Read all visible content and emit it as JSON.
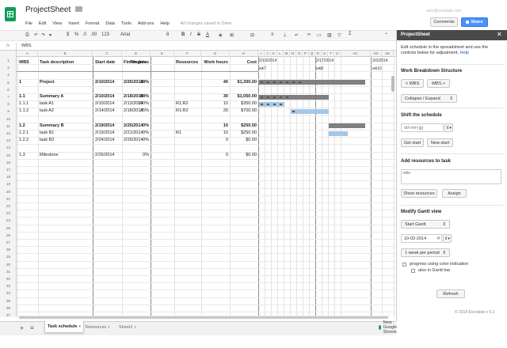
{
  "app": {
    "title": "ProjectSheet",
    "save_status": "All changes saved in Drive",
    "comments_label": "Comments",
    "share_label": "Share",
    "user_email": "user@example.com"
  },
  "menu": [
    "File",
    "Edit",
    "View",
    "Insert",
    "Format",
    "Data",
    "Tools",
    "Add-ons",
    "Help"
  ],
  "toolbar": {
    "zoom": "123",
    "font": "Arial",
    "font_size": "8"
  },
  "formula_bar": {
    "fx": "fx",
    "value": "WBS"
  },
  "columns": [
    "A",
    "B",
    "C",
    "D",
    "E",
    "F",
    "G",
    "H",
    "I",
    "J",
    "K",
    "L",
    "M",
    "N",
    "O",
    "P",
    "Q",
    "R",
    "S",
    "T",
    "U",
    "AC",
    "AD",
    "AE"
  ],
  "header_row": {
    "wbs": "WBS",
    "task": "Task description",
    "start": "Start date",
    "finish": "Finish date",
    "progress": "Progress",
    "resources": "Resources",
    "work": "Work hours",
    "cost": "Cost"
  },
  "gantt_header": {
    "date1": "2/10/2014",
    "wk1": "wk7",
    "date2": "2/17/2014",
    "wk2": "wk8",
    "date3": "3/3/2014",
    "wk3": "wk10"
  },
  "rows": [
    {
      "n": "1",
      "wbs": "WBS",
      "task": "Task description",
      "start": "Start date",
      "finish": "Finish date",
      "progress": "Progress",
      "resources": "Resources",
      "work": "Work hours",
      "cost": "Cost",
      "bold": true
    },
    {
      "n": "2",
      "wbs": "",
      "task": "",
      "start": "",
      "finish": "",
      "progress": "",
      "resources": "",
      "work": "",
      "cost": ""
    },
    {
      "n": "4",
      "wbs": "",
      "task": "",
      "start": "",
      "finish": "",
      "progress": "",
      "resources": "",
      "work": "",
      "cost": ""
    },
    {
      "n": "5",
      "wbs": "1",
      "task": "Project",
      "start": "2/10/2014",
      "finish": "2/26/2014",
      "progress": "38%",
      "resources": "",
      "work": "40",
      "cost": "$1,300.00",
      "bold": true
    },
    {
      "n": "6",
      "wbs": "",
      "task": "",
      "start": "",
      "finish": "",
      "progress": "",
      "resources": "",
      "work": "",
      "cost": ""
    },
    {
      "n": "7",
      "wbs": "1.1",
      "task": "Summary A",
      "start": "2/10/2014",
      "finish": "2/18/2014",
      "progress": "58%",
      "resources": "",
      "work": "30",
      "cost": "$1,050.00",
      "bold": true
    },
    {
      "n": "8",
      "wbs": "1.1.1",
      "task": "task A1",
      "start": "2/10/2014",
      "finish": "2/13/2014",
      "progress": "100%",
      "resources": "R1;R2",
      "work": "10",
      "cost": "$350.00"
    },
    {
      "n": "9",
      "wbs": "1.1.2",
      "task": "task A2",
      "start": "2/14/2014",
      "finish": "2/18/2014",
      "progress": "25%",
      "resources": "R1;R2",
      "work": "20",
      "cost": "$700.00"
    },
    {
      "n": "10",
      "wbs": "",
      "task": "",
      "start": "",
      "finish": "",
      "progress": "",
      "resources": "",
      "work": "",
      "cost": ""
    },
    {
      "n": "11",
      "wbs": "1.2",
      "task": "Summary B",
      "start": "2/19/2014",
      "finish": "2/25/2014",
      "progress": "0%",
      "resources": "",
      "work": "10",
      "cost": "$250.00",
      "bold": true
    },
    {
      "n": "12",
      "wbs": "1.2.1",
      "task": "task B1",
      "start": "2/19/2014",
      "finish": "2/21/2014",
      "progress": "0%",
      "resources": "R1",
      "work": "10",
      "cost": "$250.00"
    },
    {
      "n": "13",
      "wbs": "1.2.2",
      "task": "task B2",
      "start": "2/24/2014",
      "finish": "2/25/2014",
      "progress": "0%",
      "resources": "",
      "work": "0",
      "cost": "$0.00"
    },
    {
      "n": "14",
      "wbs": "",
      "task": "",
      "start": "",
      "finish": "",
      "progress": "",
      "resources": "",
      "work": "",
      "cost": ""
    },
    {
      "n": "15",
      "wbs": "1.3",
      "task": "Milestone",
      "start": "2/26/2014",
      "finish": "",
      "progress": "0%",
      "resources": "",
      "work": "0",
      "cost": "$0.00"
    }
  ],
  "empty_rows": [
    "16",
    "17",
    "18",
    "19",
    "20",
    "21",
    "22",
    "23",
    "24",
    "25",
    "26",
    "27",
    "28",
    "29",
    "30",
    "31",
    "32",
    "33",
    "34",
    "35",
    "36",
    "37",
    "38"
  ],
  "sheets": {
    "active": "Task schedule",
    "others": [
      "Resources",
      "Sheet1"
    ],
    "notice": "New Google Sheets"
  },
  "sidebar": {
    "title": "ProjectSheet",
    "intro": "Edit schedule in the spreadsheet and use the controls below for adjustment.",
    "help_link": "Help",
    "wbs_heading": "Work Breakdown Structure",
    "wbs_left": "< WBS",
    "wbs_right": "WBS >",
    "collapse_select": "Collapse / Expand",
    "shift_heading": "Shift the schedule",
    "shift_input_placeholder": "dd-mm-jjjj",
    "get_start": "Get start",
    "new_start": "New start",
    "resources_heading": "Add resources to task",
    "wbs_input_label": "wbs",
    "show_resources": "Show resources",
    "assign": "Assign",
    "gantt_heading": "Modify Gantt view",
    "start_gantt": "Start Gantt",
    "date_value": "10-02-2014",
    "period_select": "1 week per period",
    "check1": "progress using color indication",
    "check2": "also in Gantt bar",
    "refresh": "Refresh",
    "footer": "© 2014 Excelado v 0.2"
  },
  "colors": {
    "bar_dark": "#808080",
    "bar_light": "#a4c7e6",
    "accent": "#4d90fe",
    "sheets_green": "#0f9d58"
  }
}
